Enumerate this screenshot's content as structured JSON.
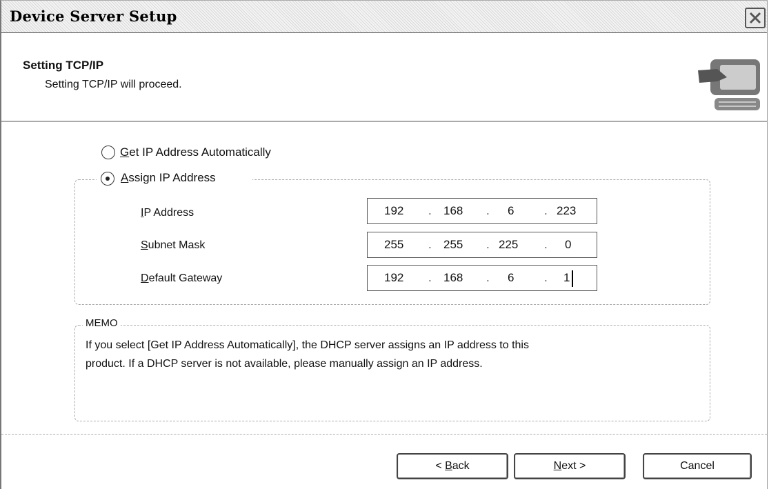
{
  "window": {
    "title": "Device Server Setup"
  },
  "header": {
    "title": "Setting TCP/IP",
    "subtitle": "Setting TCP/IP will proceed.",
    "icon": "setup-wrench-computer-icon"
  },
  "options": {
    "auto": {
      "prefix": "G",
      "rest": "et IP Address Automatically",
      "selected": false
    },
    "assign": {
      "prefix": "A",
      "rest": "ssign IP Address",
      "selected": true
    }
  },
  "fields": {
    "ip": {
      "label_prefix": "I",
      "label_rest": "P Address",
      "octets": [
        "192",
        "168",
        "6",
        "223"
      ]
    },
    "subnet": {
      "label_prefix": "S",
      "label_rest": "ubnet Mask",
      "octets": [
        "255",
        "255",
        "225",
        "0"
      ]
    },
    "gateway": {
      "label_prefix": "D",
      "label_rest": "efault Gateway",
      "octets": [
        "192",
        "168",
        "6",
        "1"
      ]
    }
  },
  "memo": {
    "legend": "MEMO",
    "line1": "If you select [Get IP Address Automatically], the DHCP server assigns an IP address to this",
    "line2": "product. If a DHCP server is not available, please manually assign an IP address."
  },
  "buttons": {
    "back_pre": "< ",
    "back_key": "B",
    "back_rest": "ack",
    "next_key": "N",
    "next_rest": "ext >",
    "cancel": "Cancel"
  }
}
